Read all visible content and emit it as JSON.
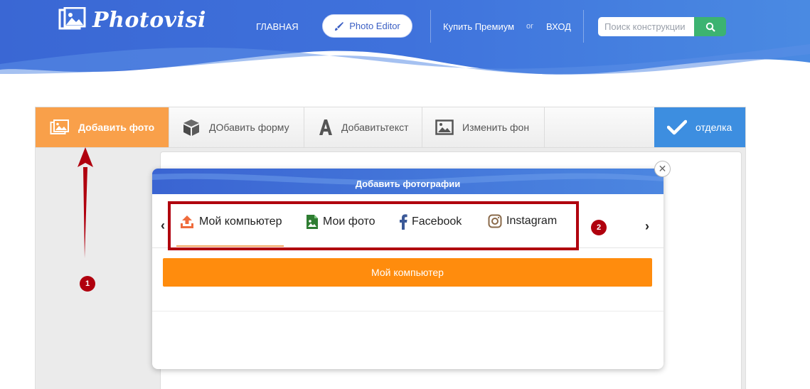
{
  "header": {
    "logo_text": "Photovisi",
    "nav": {
      "home": "ГЛАВНАЯ",
      "photo_editor": "Photo Editor",
      "premium": "Купить Премиум",
      "or": "or",
      "login": "ВХОД"
    },
    "search": {
      "placeholder": "Поиск конструкции"
    }
  },
  "toolbar": {
    "add_photo": "Добавить фото",
    "add_shape": "ДОбавить форму",
    "add_text": "Добавитьтекст",
    "change_bg": "Изменить фон",
    "finish": "отделка"
  },
  "modal": {
    "title": "Добавить фотографии",
    "tabs": [
      {
        "label": "Мой компьютер",
        "icon": "upload-icon"
      },
      {
        "label": "Мои фото",
        "icon": "image-file-icon"
      },
      {
        "label": "Facebook",
        "icon": "facebook-icon"
      },
      {
        "label": "Instagram",
        "icon": "instagram-icon"
      }
    ],
    "upload_button": "Мой компьютер"
  },
  "annotations": {
    "badge_1": "1",
    "badge_2": "2"
  },
  "colors": {
    "header_blue": "#3e6fd8",
    "accent_orange": "#f9a04a",
    "upload_orange": "#ff8c0d",
    "finish_blue": "#3d8ee0",
    "search_green": "#3cb371",
    "annotation_red": "#b0000e"
  }
}
